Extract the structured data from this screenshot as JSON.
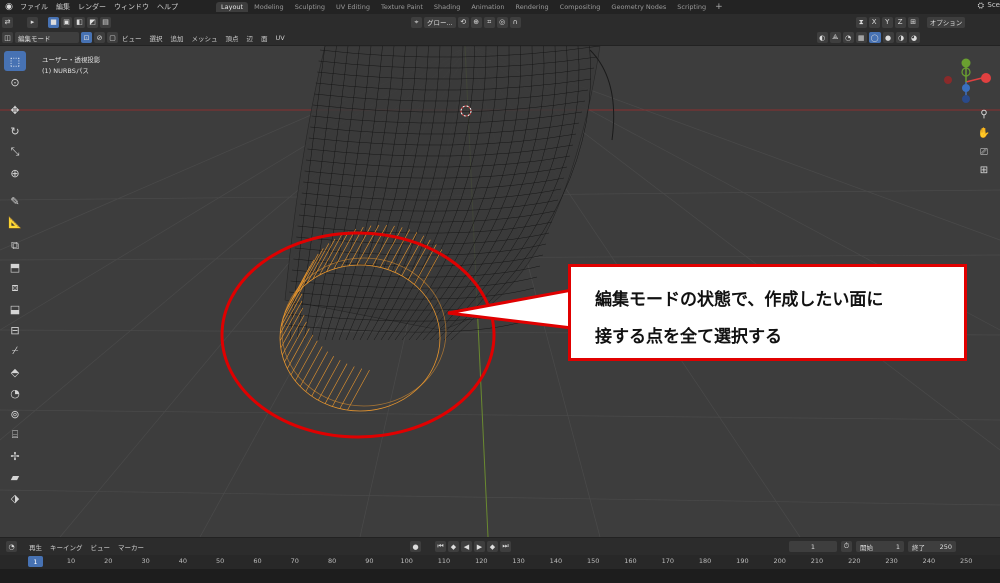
{
  "topbar": {
    "menus": [
      "ファイル",
      "編集",
      "レンダー",
      "ウィンドウ",
      "ヘルプ"
    ],
    "workspace_tabs": [
      "Layout",
      "Modeling",
      "Sculpting",
      "UV Editing",
      "Texture Paint",
      "Shading",
      "Animation",
      "Rendering",
      "Compositing",
      "Geometry Nodes",
      "Scripting"
    ],
    "active_tab": "Layout",
    "scene_label": "Sce"
  },
  "header1": {
    "transform_orientation": "グロー...",
    "options_label": "オプション",
    "axis_buttons": [
      "X",
      "Y",
      "Z"
    ]
  },
  "header2": {
    "mode": "編集モード",
    "menus": [
      "ビュー",
      "選択",
      "追加",
      "メッシュ",
      "頂点",
      "辺",
      "面",
      "UV"
    ]
  },
  "viewport": {
    "view_name": "ユーザー・透視投影",
    "object_name": "(1) NURBSパス"
  },
  "callout": {
    "line1": "編集モードの状態で、作成したい面に",
    "line2": "接する点を全て選択する",
    "border_color": "#e00000"
  },
  "timeline": {
    "menus": [
      "再生",
      "キーイング",
      "ビュー",
      "マーカー"
    ],
    "current_frame": "1",
    "start_label": "開始",
    "start_value": "1",
    "end_label": "終了",
    "end_value": "250",
    "ruler_current": "1",
    "ruler_ticks": [
      "10",
      "20",
      "30",
      "40",
      "50",
      "60",
      "70",
      "80",
      "90",
      "100",
      "110",
      "120",
      "130",
      "140",
      "150",
      "160",
      "170",
      "180",
      "190",
      "200",
      "210",
      "220",
      "230",
      "240",
      "250"
    ]
  },
  "colors": {
    "accent": "#4772b3",
    "selection": "#f0a030",
    "annotation": "#e00000"
  },
  "icons": {
    "toolbar": [
      "select-box-icon",
      "cursor-icon",
      "move-icon",
      "rotate-icon",
      "scale-icon",
      "transform-icon",
      "annotate-icon",
      "measure-icon",
      "add-cube-icon",
      "extrude-icon",
      "inset-icon",
      "bevel-icon",
      "loop-cut-icon",
      "knife-icon",
      "poly-build-icon",
      "spin-icon",
      "smooth-icon",
      "edge-slide-icon",
      "shrink-fatten-icon",
      "shear-icon",
      "rip-icon"
    ],
    "nav": [
      "zoom-icon",
      "pan-hand-icon",
      "camera-icon",
      "grid-icon"
    ]
  }
}
